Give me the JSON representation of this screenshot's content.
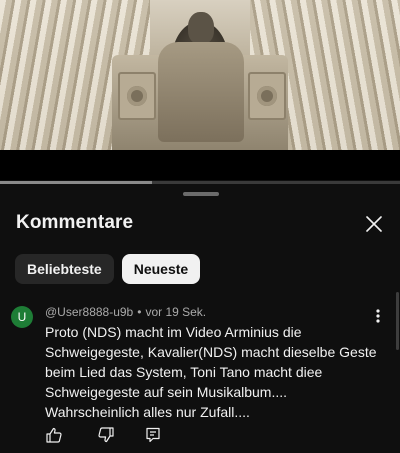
{
  "sheet": {
    "title": "Kommentare"
  },
  "player": {
    "progress": 0.38
  },
  "chips": [
    {
      "label": "Beliebteste",
      "selected": false
    },
    {
      "label": "Neueste",
      "selected": true
    }
  ],
  "comment": {
    "avatar_letter": "U",
    "avatar_color": "#1e7d36",
    "author": "@User8888-u9b",
    "separator": "•",
    "time": "vor 19 Sek.",
    "text": "Proto (NDS) macht im Video Arminius die Schweigegeste, Kavalier(NDS) macht dieselbe Geste beim Lied das System, Toni Tano macht diee Schweigegeste auf sein Musikalbum.... Wahrscheinlich alles nur Zufall...."
  },
  "icons": {
    "close": "close-icon",
    "more": "more-vert-icon",
    "like": "thumbs-up-icon",
    "dislike": "thumbs-down-icon",
    "reply": "reply-comment-icon"
  }
}
